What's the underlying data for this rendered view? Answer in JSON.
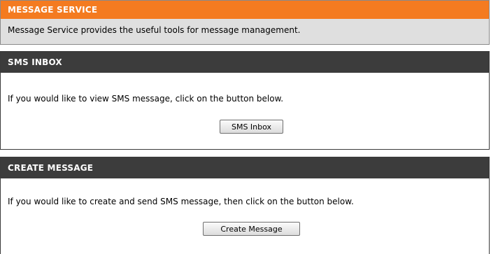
{
  "message_service": {
    "title": "MESSAGE SERVICE",
    "description": "Message Service provides the useful tools for message management."
  },
  "sms_inbox": {
    "title": "SMS INBOX",
    "description": "If you would like to view SMS message, click on the button below.",
    "button_label": "SMS Inbox"
  },
  "create_message": {
    "title": "CREATE MESSAGE",
    "description": "If you would like to create and send SMS message, then click on the button below.",
    "button_label": "Create Message"
  },
  "colors": {
    "header_orange": "#f47b20",
    "header_dark": "#3c3c3c",
    "info_background": "#dfdfdf"
  }
}
